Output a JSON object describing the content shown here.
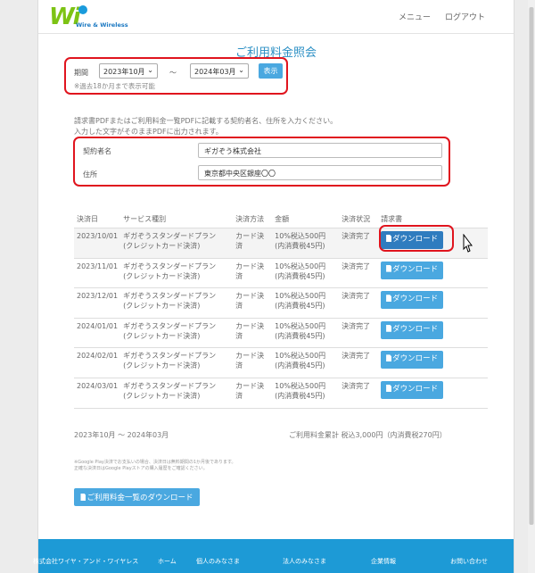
{
  "header": {
    "logo_text": "Wi",
    "logo_sub": "Wire & Wireless",
    "nav": [
      {
        "label": "メニュー"
      },
      {
        "label": "ログアウト"
      }
    ]
  },
  "page_title": "ご利用料金照会",
  "period": {
    "label": "期間",
    "from": "2023年10月",
    "separator": "～",
    "to": "2024年03月",
    "show_button": "表示",
    "note": "※過去18か月まで表示可能"
  },
  "instructions": [
    "請求書PDFまたはご利用料金一覧PDFに記載する契約者名、住所を入力ください。",
    "入力した文字がそのままPDFに出力されます。"
  ],
  "form": {
    "name_label": "契約者名",
    "name_value": "ギガぞう株式会社",
    "address_label": "住所",
    "address_value": "東京都中央区銀座〇〇"
  },
  "table": {
    "headers": [
      "決済日",
      "サービス種別",
      "決済方法",
      "金額",
      "決済状況",
      "請求書"
    ],
    "rows": [
      {
        "date": "2023/10/01",
        "service1": "ギガぞうスタンダードプラン",
        "service2": "(クレジットカード決済)",
        "method1": "カード決",
        "method2": "済",
        "amount1": "10%税込500円",
        "amount2": "(内消費税45円)",
        "status": "決済完了",
        "button": "ダウンロード"
      },
      {
        "date": "2023/11/01",
        "service1": "ギガぞうスタンダードプラン",
        "service2": "(クレジットカード決済)",
        "method1": "カード決",
        "method2": "済",
        "amount1": "10%税込500円",
        "amount2": "(内消費税45円)",
        "status": "決済完了",
        "button": "ダウンロード"
      },
      {
        "date": "2023/12/01",
        "service1": "ギガぞうスタンダードプラン",
        "service2": "(クレジットカード決済)",
        "method1": "カード決",
        "method2": "済",
        "amount1": "10%税込500円",
        "amount2": "(内消費税45円)",
        "status": "決済完了",
        "button": "ダウンロード"
      },
      {
        "date": "2024/01/01",
        "service1": "ギガぞうスタンダードプラン",
        "service2": "(クレジットカード決済)",
        "method1": "カード決",
        "method2": "済",
        "amount1": "10%税込500円",
        "amount2": "(内消費税45円)",
        "status": "決済完了",
        "button": "ダウンロード"
      },
      {
        "date": "2024/02/01",
        "service1": "ギガぞうスタンダードプラン",
        "service2": "(クレジットカード決済)",
        "method1": "カード決",
        "method2": "済",
        "amount1": "10%税込500円",
        "amount2": "(内消費税45円)",
        "status": "決済完了",
        "button": "ダウンロード"
      },
      {
        "date": "2024/03/01",
        "service1": "ギガぞうスタンダードプラン",
        "service2": "(クレジットカード決済)",
        "method1": "カード決",
        "method2": "済",
        "amount1": "10%税込500円",
        "amount2": "(内消費税45円)",
        "status": "決済完了",
        "button": "ダウンロード"
      }
    ]
  },
  "summary": {
    "range": "2023年10月 ～ 2024年03月",
    "total": "ご利用料金累計 税込3,000円（内消費税270円）"
  },
  "fine_print": [
    "※Google Play決済でお支払いの場合、決済日は無料期間の1か月後であります。",
    "正確な決済日はGoogle Playストアの購入履歴をご確認ください。"
  ],
  "list_download_button": "ご利用料金一覧のダウンロード",
  "footer": {
    "company": "株式会社ワイヤ・アンド・ワイヤレス",
    "links": [
      {
        "label": "ホーム"
      },
      {
        "label": "個人のみなさま"
      },
      {
        "label": "法人のみなさま"
      },
      {
        "label": "企業情報"
      },
      {
        "label": "お問い合わせ"
      }
    ]
  },
  "colors": {
    "accent": "#4aa8e0",
    "highlight_box": "#e0141e",
    "footer": "#1d9ad6"
  }
}
